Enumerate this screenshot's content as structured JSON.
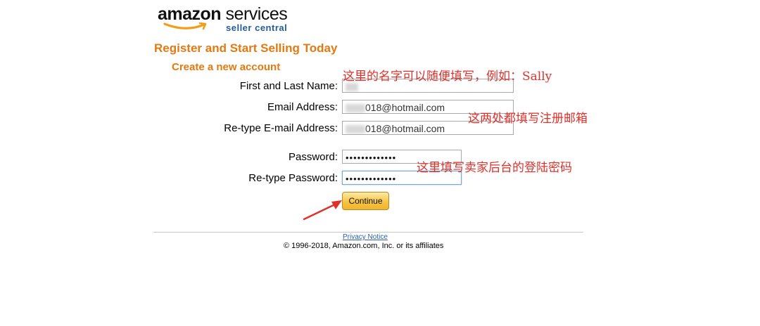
{
  "logo": {
    "brand": "amazon",
    "product": " services",
    "tagline": "seller central"
  },
  "page_title": "Register and Start Selling Today",
  "section_title": "Create a new account",
  "form": {
    "name": {
      "label": "First and Last Name:",
      "value": ""
    },
    "email": {
      "label": "Email Address:",
      "value": "018@hotmail.com"
    },
    "email_confirm": {
      "label": "Re-type E-mail Address:",
      "value": "018@hotmail.com"
    },
    "password": {
      "label": "Password:",
      "value": "•••••••••••••"
    },
    "password_confirm": {
      "label": "Re-type Password:",
      "value": "•••••••••••••"
    },
    "continue_label": "Continue"
  },
  "annotations": {
    "name_note": "这里的名字可以随便填写，例如：Sally",
    "email_note": "这两处都填写注册邮箱",
    "password_note": "这里填写卖家后台的登陆密码"
  },
  "footer": {
    "privacy_link": "Privacy Notice",
    "copyright": "© 1996-2018, Amazon.com, Inc. or its affiliates"
  },
  "colors": {
    "accent_orange": "#e47911",
    "annotation_red": "#e0302a",
    "link_blue": "#2b5fb0",
    "button_gold": "#f6c544"
  }
}
